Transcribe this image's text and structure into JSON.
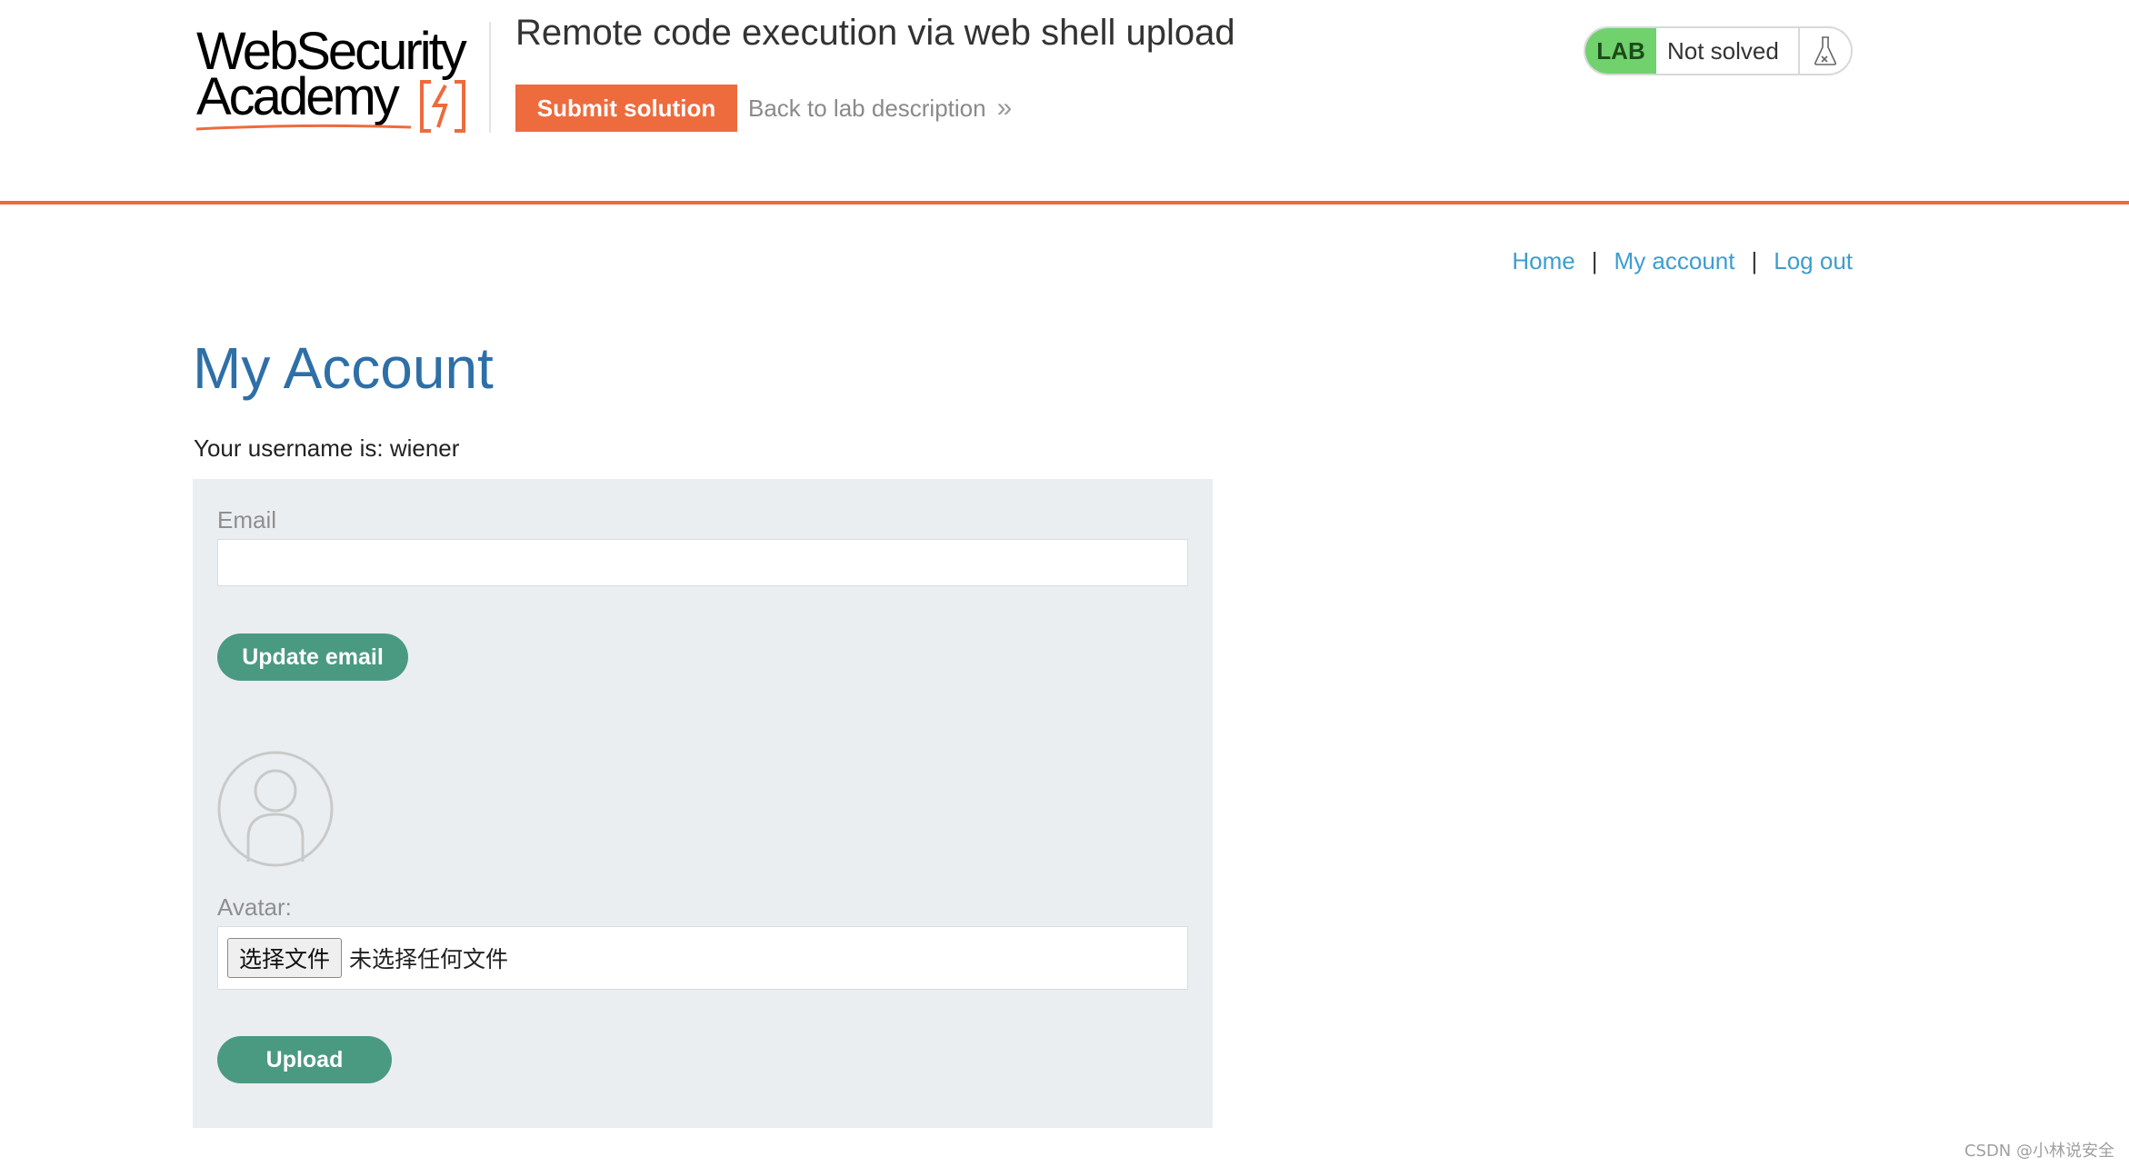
{
  "header": {
    "logo_line1": "WebSecurity",
    "logo_line2": "Academy",
    "lab_title": "Remote code execution via web shell upload",
    "submit_label": "Submit solution",
    "back_label": "Back to lab description",
    "back_chevron": "»",
    "status_badge": "LAB",
    "status_text": "Not solved",
    "status_icon": "flask-icon"
  },
  "nav": {
    "home": "Home",
    "separator": "|",
    "my_account": "My account",
    "log_out": "Log out"
  },
  "main": {
    "title": "My Account",
    "username_line": "Your username is: wiener",
    "email_label": "Email",
    "email_value": "",
    "update_email_label": "Update email",
    "avatar_icon": "user-avatar-icon",
    "avatar_label": "Avatar:",
    "choose_file_label": "选择文件",
    "no_file_text": "未选择任何文件",
    "upload_label": "Upload"
  },
  "watermark": "CSDN @小林说安全",
  "colors": {
    "accent_orange": "#ee6b3d",
    "lab_green": "#70d16d",
    "link_blue": "#3c9dd0",
    "title_blue": "#2e6fa7",
    "button_teal": "#4a9a82",
    "panel_bg": "#ebeef1"
  }
}
